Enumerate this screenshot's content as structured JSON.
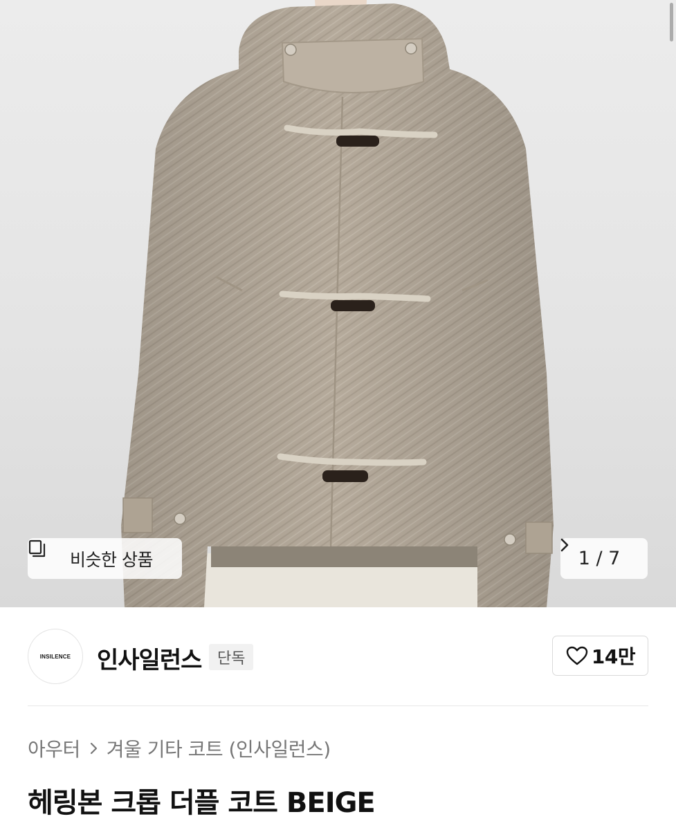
{
  "gallery": {
    "image_label": "beige herringbone cropped hooded duffle coat with toggle fastenings",
    "similar_button_label": "비슷한 상품",
    "similar_icon": "similar-items-icon",
    "page_counter": "1 / 7",
    "next_icon": "chevron-right-icon"
  },
  "brand": {
    "logo_text": "INSILENCE",
    "name": "인사일런스",
    "badge": "단독",
    "like_icon": "heart-outline-icon",
    "like_count": "14만"
  },
  "breadcrumb": {
    "items": [
      "아우터",
      "겨울 기타 코트 (인사일런스)"
    ]
  },
  "product": {
    "title": "헤링본 크롭 더플 코트 BEIGE"
  },
  "colors": {
    "coat": "#b5aa9b",
    "background": "#e6e6e6"
  }
}
